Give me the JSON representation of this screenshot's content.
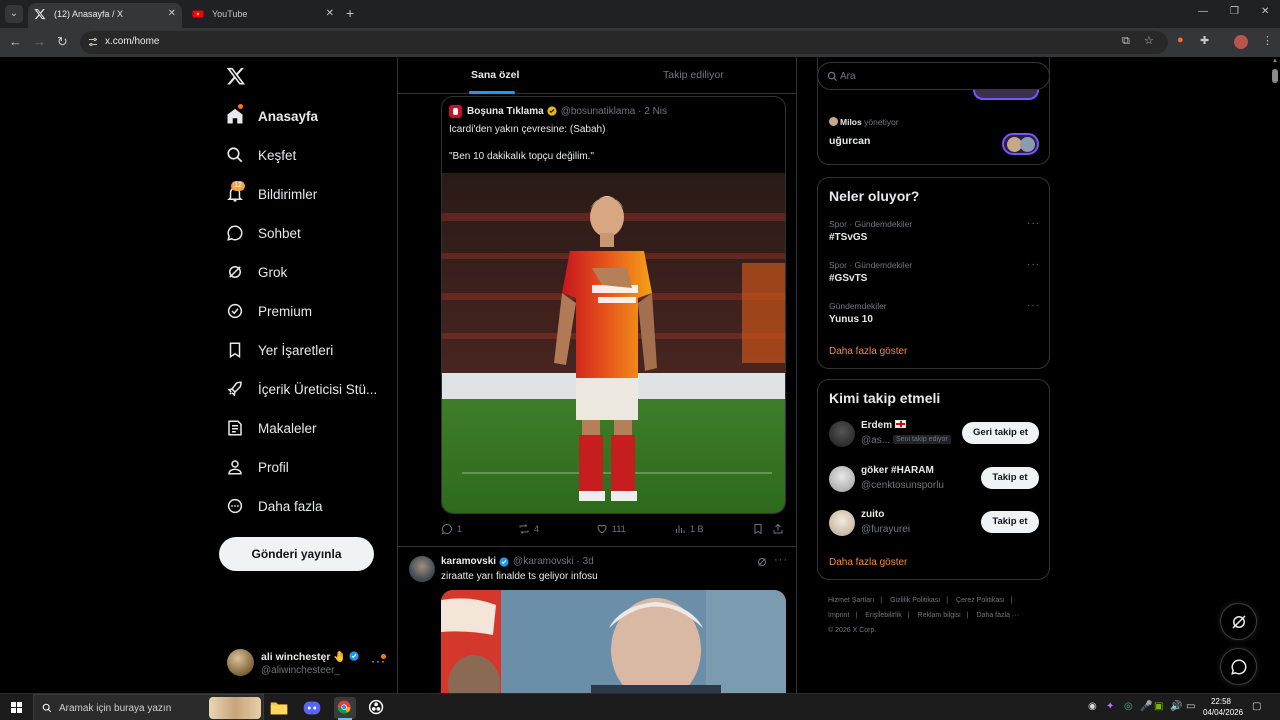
{
  "browser": {
    "tabs": [
      {
        "title": "(12) Anasayfa / X",
        "active": true
      },
      {
        "title": "YouTube",
        "active": false
      }
    ],
    "url": "x.com/home"
  },
  "nav": {
    "items": [
      {
        "label": "Anasayfa",
        "icon": "home-icon"
      },
      {
        "label": "Keşfet",
        "icon": "search-icon"
      },
      {
        "label": "Bildirimler",
        "icon": "bell-icon",
        "badge": "12"
      },
      {
        "label": "Sohbet",
        "icon": "chat-icon"
      },
      {
        "label": "Grok",
        "icon": "grok-icon"
      },
      {
        "label": "Premium",
        "icon": "premium-icon"
      },
      {
        "label": "Yer İşaretleri",
        "icon": "bookmark-icon"
      },
      {
        "label": "İçerik Üreticisi Stü...",
        "icon": "rocket-icon"
      },
      {
        "label": "Makaleler",
        "icon": "articles-icon"
      },
      {
        "label": "Profil",
        "icon": "profile-icon"
      },
      {
        "label": "Daha fazla",
        "icon": "more-circle-icon"
      }
    ],
    "post_button": "Gönderi yayınla",
    "account": {
      "name": "ali winchestęr 🤚",
      "handle": "@aliwinchesteer_"
    }
  },
  "feed": {
    "tabs": [
      "Sana özel",
      "Takip ediliyor"
    ],
    "quote": {
      "name": "Boşuna Tıklama",
      "meta": "@bosunatiklama · 2 Nis",
      "line1": "Icardi'den yakın çevresine: (Sabah)",
      "line2": "\"Ben 10 dakikalık topçu değilim.\""
    },
    "actions": {
      "replies": "1",
      "reposts": "4",
      "likes": "111",
      "views": "1 B"
    },
    "tweet2": {
      "name": "karamovski",
      "meta": "@karamovski · 3d",
      "text": "ziraatte yarı finalde ts geliyor infosu"
    }
  },
  "right": {
    "search_placeholder": "Ara",
    "space": {
      "host": "Milos",
      "host_suffix": "yönetiyor",
      "title": "uğurcan"
    },
    "trends": {
      "title": "Neler oluyor?",
      "items": [
        {
          "meta": "Spor · Gündemdekiler",
          "name": "#TSvGS"
        },
        {
          "meta": "Spor · Gündemdekiler",
          "name": "#GSvTS"
        },
        {
          "meta": "Gündemdekiler",
          "name": "Yunus 10"
        }
      ],
      "more": "Daha fazla göster"
    },
    "who_to_follow": {
      "title": "Kimi takip etmeli",
      "items": [
        {
          "name": "Erdem",
          "handle": "@as...",
          "follows_you": "Seni takip ediyor",
          "button": "Geri takip et"
        },
        {
          "name": "göker #HARAM",
          "handle": "@cenktosunsporlu",
          "button": "Takip et"
        },
        {
          "name": "zuito",
          "handle": "@furayurei",
          "button": "Takip et"
        }
      ],
      "more": "Daha fazla göster"
    },
    "footer": {
      "row1": [
        "Hizmet Şartları",
        "Gizlilik Politikası",
        "Çerez Politikası"
      ],
      "row2": [
        "Imprint",
        "Erişilebilirlik",
        "Reklam bilgisi",
        "Daha fazla ···"
      ],
      "copyright": "© 2026 X Corp."
    }
  },
  "taskbar": {
    "search_placeholder": "Aramak için buraya yazın",
    "time": "22:58",
    "date": "04/04/2026"
  },
  "colors": {
    "accent": "#1d9bf0",
    "link_orange": "#f58a3a",
    "notification": "#f7a344"
  }
}
